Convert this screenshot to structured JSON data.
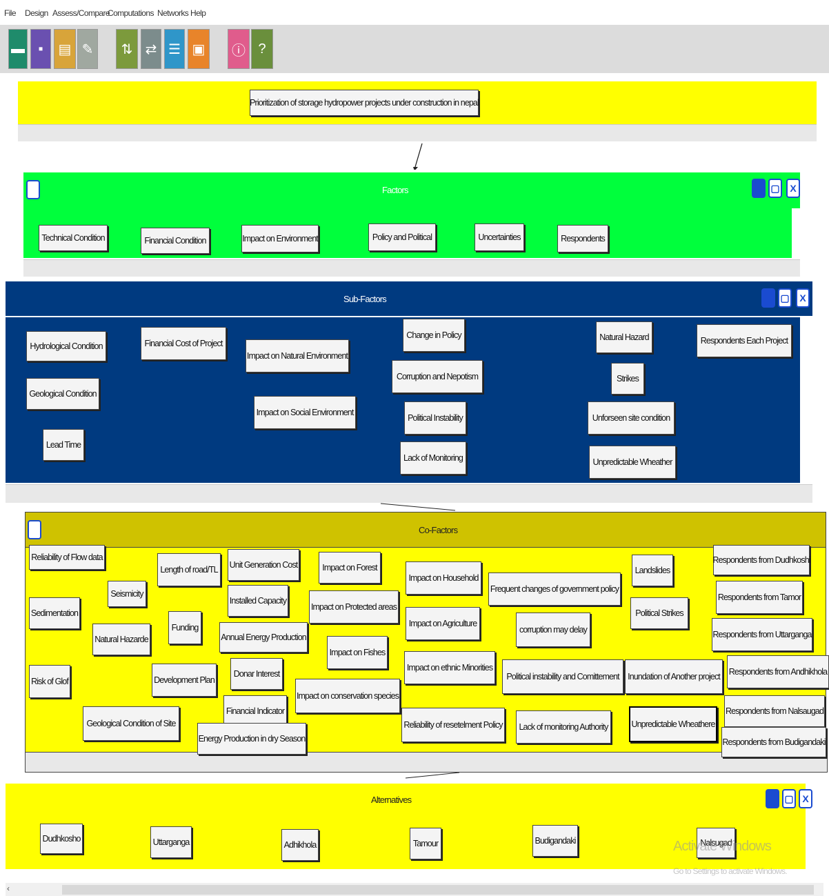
{
  "menu": [
    "File",
    "Design",
    "Assess/Compare",
    "Computations",
    "Networks",
    "Help"
  ],
  "goal": {
    "label": "Prioritization of storage hydropower projects under construction in nepal"
  },
  "factors": {
    "title": "Factors",
    "items": [
      "Technical Condition",
      "Financial Condition",
      "Impact on Environment",
      "Policy and Political",
      "Uncertainties",
      "Respondents"
    ]
  },
  "subfactors": {
    "title": "Sub-Factors",
    "items": [
      "Hydrological Condition",
      "Geological Condition",
      "Lead Time",
      "Financial Cost of Project",
      "Impact on Natural Environment",
      "Impact on Social Environment",
      "Change in Policy",
      "Corruption and Nepotism",
      "Political Instability",
      "Lack of Monitoring",
      "Natural Hazard",
      "Strikes",
      "Unforseen site condition",
      "Unpredictable Wheather",
      "Respondents Each Project"
    ]
  },
  "cofactors": {
    "title": "Co-Factors",
    "items": [
      "Reliability of Flow data",
      "Seismicity",
      "Sedimentation",
      "Natural Hazarde",
      "Risk of Glof",
      "Geological Condition of Site",
      "Length of road/TL",
      "Funding",
      "Development Plan",
      "Unit Generation Cost",
      "Installed Capacity",
      "Annual Energy Production",
      "Donar Interest",
      "Financial Indicator",
      "Energy Production in dry Season",
      "Impact on Forest",
      "Impact on Protected areas",
      "Impact on Fishes",
      "Impact on conservation species",
      "Impact on Household",
      "Impact on Agriculture",
      "Impact on ethnic Minorities",
      "Reliability of resetelment Policy",
      "Frequent changes of government policy",
      "corruption may delay",
      "Political instability and Comittement",
      "Lack of monitoring Authority",
      "Landslides",
      "Political Strikes",
      "Inundation of Another project",
      "Unpredictable Wheathere",
      "Respondents from Dudhkoshi",
      "Respondents from Tamor",
      "Respondents from Uttarganga",
      "Respondents from Andhikhola",
      "Respondents from Nalsaugad",
      "Respondents from Budigandaki"
    ]
  },
  "alternatives": {
    "title": "Alternatives",
    "items": [
      "Dudhkosho",
      "Uttarganga",
      "Adhikhola",
      "Tamour",
      "Budigandaki",
      "Nalsugad"
    ]
  },
  "watermark": {
    "line1": "Activate Windows",
    "line2": "Go to Settings to activate Windows."
  },
  "colors": {
    "goal": "#ffff00",
    "factors": "#00ff3c",
    "subfactors": "#003a80",
    "cofactors_header": "#cfc200",
    "cofactors_body": "#ffff00",
    "alternatives": "#ffff00",
    "window_button": "#1a4bd0"
  },
  "toolbar_icons": [
    "open-icon",
    "save-icon",
    "print-icon",
    "edit-icon",
    "sort-icon",
    "compare-icon",
    "settings-icon",
    "export-icon",
    "info-icon",
    "help-icon"
  ]
}
